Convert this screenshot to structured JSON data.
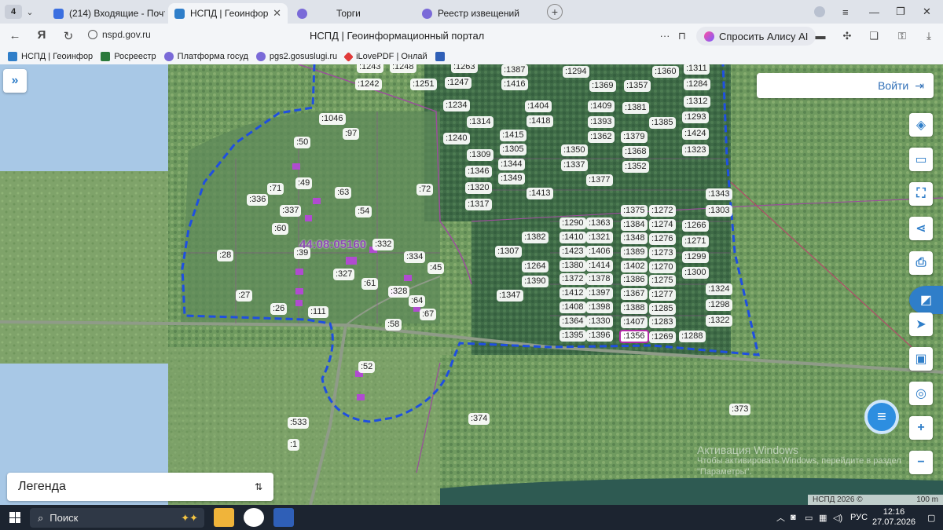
{
  "browser": {
    "tab_count": "4",
    "tabs": [
      {
        "label": "(214) Входящие - Почта",
        "active": false
      },
      {
        "label": "НСПД | Геоинформац",
        "active": true
      },
      {
        "label": "Торги",
        "active": false
      },
      {
        "label": "Реестр извещений",
        "active": false
      }
    ],
    "url": "nspd.gov.ru",
    "page_title": "НСПД | Геоинформационный портал",
    "alice_label": "Спросить Алису AI",
    "bookmarks": [
      "НСПД | Геоинфор",
      "Росреестр",
      "Платформа госуд",
      "pgs2.gosuslugi.ru",
      "iLovePDF | Онлай"
    ]
  },
  "map": {
    "login_label": "Войти",
    "legend_label": "Легенда",
    "cadastral_quarter": "44:08:05160",
    "parcels": [
      {
        "t": ":1263"
      },
      {
        "t": ":1243"
      },
      {
        "t": ":1248"
      },
      {
        "t": ":1242"
      },
      {
        "t": ":1251"
      },
      {
        "t": ":1247"
      },
      {
        "t": ":1387"
      },
      {
        "t": ":1416"
      },
      {
        "t": ":1294"
      },
      {
        "t": ":1369"
      },
      {
        "t": ":1357"
      },
      {
        "t": ":1360"
      },
      {
        "t": ":1311"
      },
      {
        "t": ":1284"
      },
      {
        "t": ":1234"
      },
      {
        "t": ":1404"
      },
      {
        "t": ":1409"
      },
      {
        "t": ":1381"
      },
      {
        "t": ":1312"
      },
      {
        "t": ":1046"
      },
      {
        "t": ":1314"
      },
      {
        "t": ":1418"
      },
      {
        "t": ":1393"
      },
      {
        "t": ":1385"
      },
      {
        "t": ":1293"
      },
      {
        "t": ":97"
      },
      {
        "t": ":1415"
      },
      {
        "t": ":1362"
      },
      {
        "t": ":1379"
      },
      {
        "t": ":1424"
      },
      {
        "t": ":50"
      },
      {
        "t": ":1240"
      },
      {
        "t": ":1305"
      },
      {
        "t": ":1350"
      },
      {
        "t": ":1368"
      },
      {
        "t": ":1323"
      },
      {
        "t": ":1309"
      },
      {
        "t": ":1344"
      },
      {
        "t": ":1337"
      },
      {
        "t": ":1352"
      },
      {
        "t": ":1346"
      },
      {
        "t": ":1349"
      },
      {
        "t": ":1377"
      },
      {
        "t": ":49"
      },
      {
        "t": ":71"
      },
      {
        "t": ":72"
      },
      {
        "t": ":1320"
      },
      {
        "t": ":63"
      },
      {
        "t": ":1413"
      },
      {
        "t": ":1343"
      },
      {
        "t": ":336"
      },
      {
        "t": ":1317"
      },
      {
        "t": ":1375"
      },
      {
        "t": ":1272"
      },
      {
        "t": ":1303"
      },
      {
        "t": ":337"
      },
      {
        "t": ":54"
      },
      {
        "t": ":1290"
      },
      {
        "t": ":1363"
      },
      {
        "t": ":1384"
      },
      {
        "t": ":1274"
      },
      {
        "t": ":1266"
      },
      {
        "t": ":60"
      },
      {
        "t": ":1382"
      },
      {
        "t": ":1410"
      },
      {
        "t": ":1321"
      },
      {
        "t": ":1348"
      },
      {
        "t": ":1276"
      },
      {
        "t": ":1271"
      },
      {
        "t": ":332"
      },
      {
        "t": ":1307"
      },
      {
        "t": ":1423"
      },
      {
        "t": ":1406"
      },
      {
        "t": ":1389"
      },
      {
        "t": ":1273"
      },
      {
        "t": ":28"
      },
      {
        "t": ":39"
      },
      {
        "t": ":334"
      },
      {
        "t": ":1299"
      },
      {
        "t": ":1264"
      },
      {
        "t": ":1380"
      },
      {
        "t": ":1414"
      },
      {
        "t": ":1402"
      },
      {
        "t": ":1270"
      },
      {
        "t": ":45"
      },
      {
        "t": ":327"
      },
      {
        "t": ":1300"
      },
      {
        "t": ":1372"
      },
      {
        "t": ":1378"
      },
      {
        "t": ":1386"
      },
      {
        "t": ":1275"
      },
      {
        "t": ":1390"
      },
      {
        "t": ":61"
      },
      {
        "t": ":1324"
      },
      {
        "t": ":1412"
      },
      {
        "t": ":1397"
      },
      {
        "t": ":1367"
      },
      {
        "t": ":1277"
      },
      {
        "t": ":27"
      },
      {
        "t": ":328"
      },
      {
        "t": ":1347"
      },
      {
        "t": ":64"
      },
      {
        "t": ":1408"
      },
      {
        "t": ":1398"
      },
      {
        "t": ":1388"
      },
      {
        "t": ":1285"
      },
      {
        "t": ":1298"
      },
      {
        "t": ":26"
      },
      {
        "t": ":111"
      },
      {
        "t": ":67"
      },
      {
        "t": ":1364"
      },
      {
        "t": ":1330"
      },
      {
        "t": ":1407"
      },
      {
        "t": ":1283"
      },
      {
        "t": ":1322"
      },
      {
        "t": ":58"
      },
      {
        "t": ":1395"
      },
      {
        "t": ":1396"
      },
      {
        "t": ":1356",
        "hl": true
      },
      {
        "t": ":1269"
      },
      {
        "t": ":1288"
      },
      {
        "t": ":52"
      },
      {
        "t": ":373"
      },
      {
        "t": ":374"
      },
      {
        "t": ":533"
      },
      {
        "t": ":1"
      }
    ],
    "scale_left": "НСПД 2026 ©",
    "scale_right": "100 m"
  },
  "watermark": {
    "title": "Активация Windows",
    "line1": "Чтобы активировать Windows, перейдите в раздел",
    "line2": "\"Параметры\"."
  },
  "taskbar": {
    "search_placeholder": "Поиск",
    "lang": "РУС",
    "time": "12:16",
    "date": "27.07.2026"
  }
}
